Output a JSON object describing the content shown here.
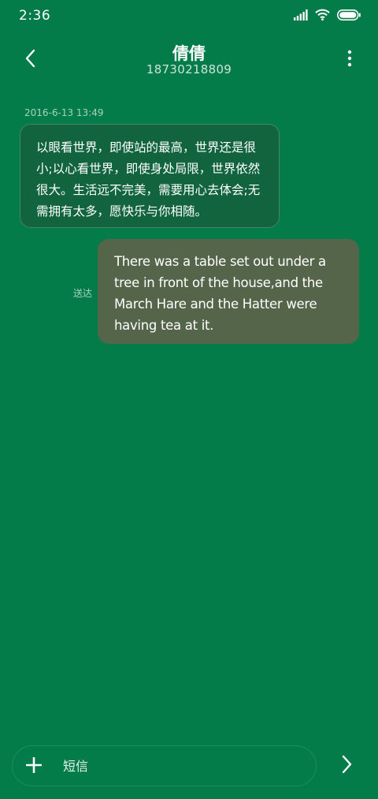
{
  "status_bar": {
    "time": "2:36",
    "icons": [
      "signal-icon",
      "wifi-icon",
      "battery-icon"
    ]
  },
  "header": {
    "contact_name": "倩倩",
    "phone_number": "18730218809",
    "back_icon": "chevron-left-icon",
    "more_icon": "more-vertical-icon"
  },
  "conversation": {
    "timestamp": "2016-6-13 13:49",
    "messages": [
      {
        "direction": "incoming",
        "text": "以眼看世界，即使站的最高，世界还是很小;以心看世界，即使身处局限，世界依然很大。生活远不完美，需要用心去体会;无需拥有太多，愿快乐与你相随。"
      },
      {
        "direction": "outgoing",
        "text": "There was a table set out under a tree in front of the house,and the March Hare and the Hatter were having tea at it.",
        "status": "送达"
      }
    ]
  },
  "composer": {
    "placeholder": "短信",
    "value": "",
    "add_icon": "plus-icon",
    "send_icon": "chevron-right-icon"
  },
  "colors": {
    "background": "#037c49",
    "incoming_bubble": "#11643d",
    "outgoing_bubble": "#55654a",
    "text": "#ffffff"
  }
}
